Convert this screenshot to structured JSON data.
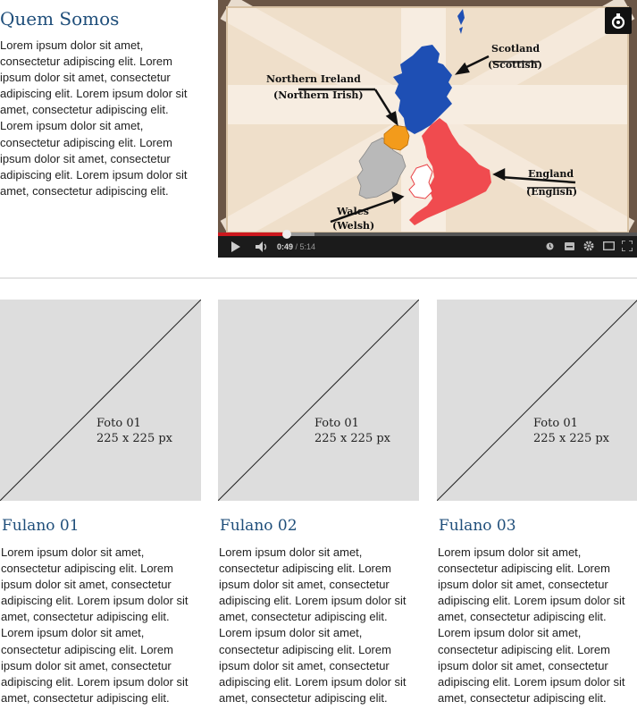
{
  "about": {
    "title": "Quem Somos",
    "text": "Lorem ipsum dolor sit amet, consectetur adipiscing elit. Lorem ipsum dolor sit amet, consectetur adipiscing elit. Lorem ipsum dolor sit amet, consectetur adipiscing elit. Lorem ipsum dolor sit amet, consectetur adipiscing elit. Lorem ipsum dolor sit amet, consectetur adipiscing elit. Lorem ipsum dolor sit amet, consectetur adipiscing elit."
  },
  "video": {
    "labels": {
      "scotland": "Scotland",
      "scottish": "(Scottish)",
      "northern_ireland": "Northern Ireland",
      "northern_irish": "(Northern Irish)",
      "england": "England",
      "english": "(English)",
      "wales": "Wales",
      "welsh": "(Welsh)"
    },
    "time_current": "0:49",
    "time_separator": " / ",
    "time_total": "5:14",
    "progress_played": 0.165,
    "progress_buffered": 0.23,
    "colors": {
      "scotland": "#1e4fb4",
      "northern_ireland": "#f39b1b",
      "england": "#f04b4f",
      "wales": "#ffffff",
      "ireland": "#b9b9b9",
      "played": "#cc181e"
    },
    "icons": [
      "play-icon",
      "volume-icon",
      "watch-later-icon",
      "captions-icon",
      "settings-icon",
      "theater-icon",
      "fullscreen-icon",
      "channel-logo-icon"
    ]
  },
  "team": [
    {
      "photo_line1": "Foto 01",
      "photo_line2": "225 x 225 px",
      "name": "Fulano 01",
      "text": "Lorem ipsum dolor sit amet, consectetur adipiscing elit. Lorem ipsum dolor sit amet, consectetur adipiscing elit. Lorem ipsum dolor sit amet, consectetur adipiscing elit. Lorem ipsum dolor sit amet, consectetur adipiscing elit. Lorem ipsum dolor sit amet, consectetur adipiscing elit. Lorem ipsum dolor sit amet, consectetur adipiscing elit."
    },
    {
      "photo_line1": "Foto 01",
      "photo_line2": "225 x 225 px",
      "name": "Fulano 02",
      "text": "Lorem ipsum dolor sit amet, consectetur adipiscing elit. Lorem ipsum dolor sit amet, consectetur adipiscing elit. Lorem ipsum dolor sit amet, consectetur adipiscing elit. Lorem ipsum dolor sit amet, consectetur adipiscing elit. Lorem ipsum dolor sit amet, consectetur adipiscing elit. Lorem ipsum dolor sit amet, consectetur adipiscing elit."
    },
    {
      "photo_line1": "Foto 01",
      "photo_line2": "225 x 225 px",
      "name": "Fulano 03",
      "text": "Lorem ipsum dolor sit amet, consectetur adipiscing elit. Lorem ipsum dolor sit amet, consectetur adipiscing elit. Lorem ipsum dolor sit amet, consectetur adipiscing elit. Lorem ipsum dolor sit amet, consectetur adipiscing elit. Lorem ipsum dolor sit amet, consectetur adipiscing elit. Lorem ipsum dolor sit amet, consectetur adipiscing elit."
    }
  ]
}
